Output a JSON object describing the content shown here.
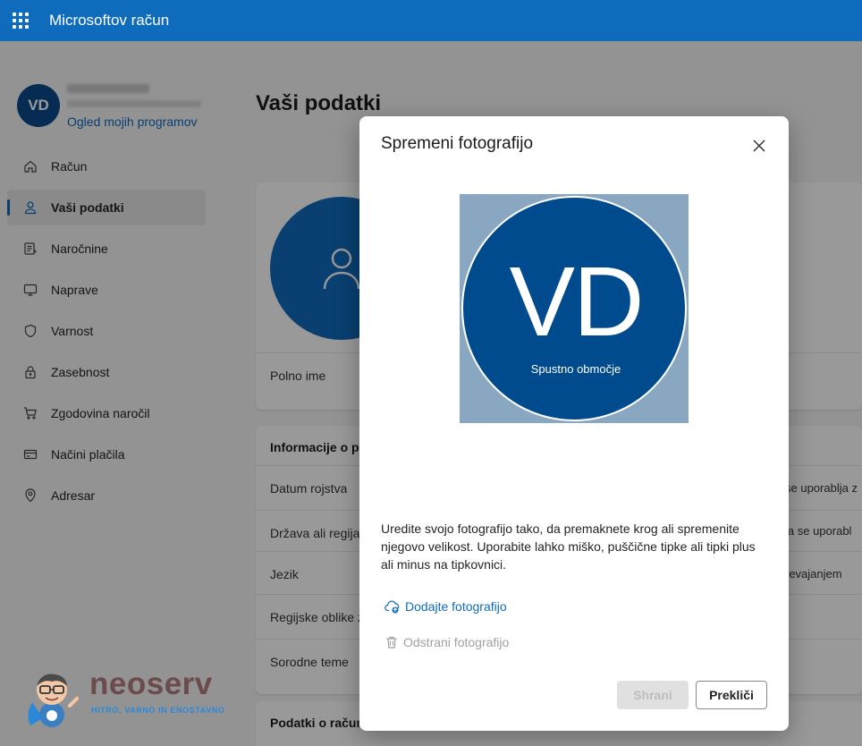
{
  "header": {
    "title": "Microsoftov račun",
    "waffle_icon": "waffle-icon"
  },
  "profile": {
    "initials": "VD",
    "apps_link": "Ogled mojih programov"
  },
  "sidebar": {
    "items": [
      {
        "label": "Račun",
        "icon": "home-icon"
      },
      {
        "label": "Vaši podatki",
        "icon": "person-icon"
      },
      {
        "label": "Naročnine",
        "icon": "subscriptions-icon"
      },
      {
        "label": "Naprave",
        "icon": "monitor-icon"
      },
      {
        "label": "Varnost",
        "icon": "shield-icon"
      },
      {
        "label": "Zasebnost",
        "icon": "lock-icon"
      },
      {
        "label": "Zgodovina naročil",
        "icon": "cart-icon"
      },
      {
        "label": "Načini plačila",
        "icon": "card-icon"
      },
      {
        "label": "Adresar",
        "icon": "location-icon"
      }
    ]
  },
  "main": {
    "title": "Vaši podatki",
    "card1": {
      "full_name_label": "Polno ime"
    },
    "card2": {
      "heading": "Informacije o pr",
      "rows": [
        "Datum rojstva",
        "Država ali regija",
        "Jezik",
        "Regijske oblike z",
        "Sorodne teme"
      ],
      "right_texts": [
        "se uporablja z",
        "ja se uporabl",
        "revajanjem"
      ]
    },
    "card3": {
      "heading": "Podatki o račun"
    }
  },
  "dialog": {
    "title": "Spremeni fotografijo",
    "initials": "VD",
    "drop_area": "Spustno območje",
    "description": "Uredite svojo fotografijo tako, da premaknete krog ali spremenite njegovo velikost. Uporabite lahko miško, puščične tipke ali tipki plus ali minus na tipkovnici.",
    "add_photo": "Dodajte fotografijo",
    "remove_photo": "Odstrani fotografijo",
    "save": "Shrani",
    "cancel": "Prekliči"
  },
  "watermark": {
    "brand": "neoserv",
    "tagline": "HITRO, VARNO IN ENOSTAVNO"
  },
  "colors": {
    "accent": "#0f6cbd",
    "avatar_bg": "#004b8d",
    "crop_bg": "#8aa7c1"
  }
}
